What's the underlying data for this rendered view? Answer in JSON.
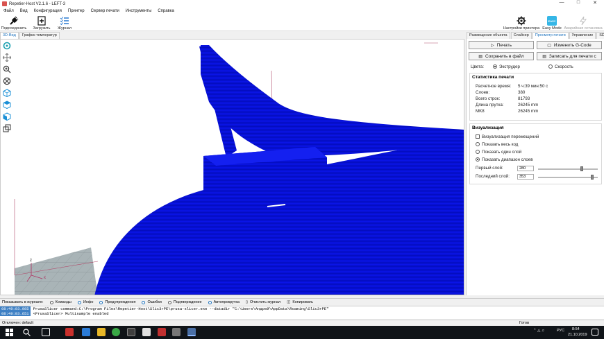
{
  "window": {
    "title": "Repetier-Host V2.1.6 - LEFT-3"
  },
  "menu": [
    "Файл",
    "Вид",
    "Конфигурация",
    "Принтер",
    "Сервер печати",
    "Инструменты",
    "Справка"
  ],
  "toolbar": {
    "connect": "Подсоединить",
    "load": "Загрузить",
    "log": "Журнал",
    "printer_settings": "Настройки принтера",
    "easy_mode": "Easy Mode",
    "easy_mode_badge": "EASY",
    "emergency_stop": "Аварийная остановка"
  },
  "view_tabs": [
    "3D-Вид",
    "График температур"
  ],
  "panel_tabs": [
    "Размещение объекта",
    "Слайсер",
    "Просмотр печати",
    "Управление",
    "SD-карта"
  ],
  "panel": {
    "print_button": "Печать",
    "edit_gcode_button": "Изменить G-Code",
    "save_file_button": "Сохранить в файл",
    "save_sd_button": "Записать для печати с",
    "color_label": "Цвета:",
    "color_extruder": "Экструдер",
    "color_speed": "Скорость",
    "stats_title": "Статистика печати",
    "stats": [
      {
        "label": "Расчетное время:",
        "value": "5 ч:39 мин:50 с"
      },
      {
        "label": "Слоев:",
        "value": "380"
      },
      {
        "label": "Всего строк:",
        "value": "81793"
      },
      {
        "label": "Длина прутка:",
        "value": "26245 mm"
      },
      {
        "label": "MK8",
        "value": "26245 mm"
      }
    ],
    "viz_title": "Визуализация",
    "viz_moves": "Визуализация перемещений",
    "viz_all": "Показать весь код",
    "viz_one": "Показать один слой",
    "viz_range": "Показать диапазон слоев",
    "first_layer_label": "Первый слой:",
    "first_layer_value": "280",
    "last_layer_label": "Последний слой:",
    "last_layer_value": "353",
    "first_layer_fraction": 0.74,
    "last_layer_fraction": 0.93
  },
  "logbar": {
    "show_in_log": "Показывать в журнале:",
    "commands": "Команды",
    "info": "Инфо",
    "warnings": "Предупреждения",
    "errors": "Ошибки",
    "confirmations": "Подтверждение",
    "autoscroll": "Автопрокрутка",
    "clear": "Очистить журнал",
    "copy": "Копировать"
  },
  "log": [
    {
      "time": "08:49:03.985",
      "text": "PrusaSlicer command:C:\\Program Files\\Repetier-Host\\Slic3rPE\\prusa-slicer.exe  --datadir \"C:\\Users\\Андрей\\AppData\\Roaming\\Slic3rPE\""
    },
    {
      "time": "08:49:03.651",
      "text": "<PrusaSlicer> Multisample enabled"
    }
  ],
  "status": {
    "connection": "Отключен: default",
    "ready": "Готов"
  },
  "taskbar": {
    "lang": "РУС",
    "time": "8:54",
    "date": "21.10.2019"
  },
  "colors": {
    "model": "#0a14e6",
    "accent": "#1e73be",
    "grid": "#a9b4b7",
    "log_time": "#3e80c4"
  }
}
